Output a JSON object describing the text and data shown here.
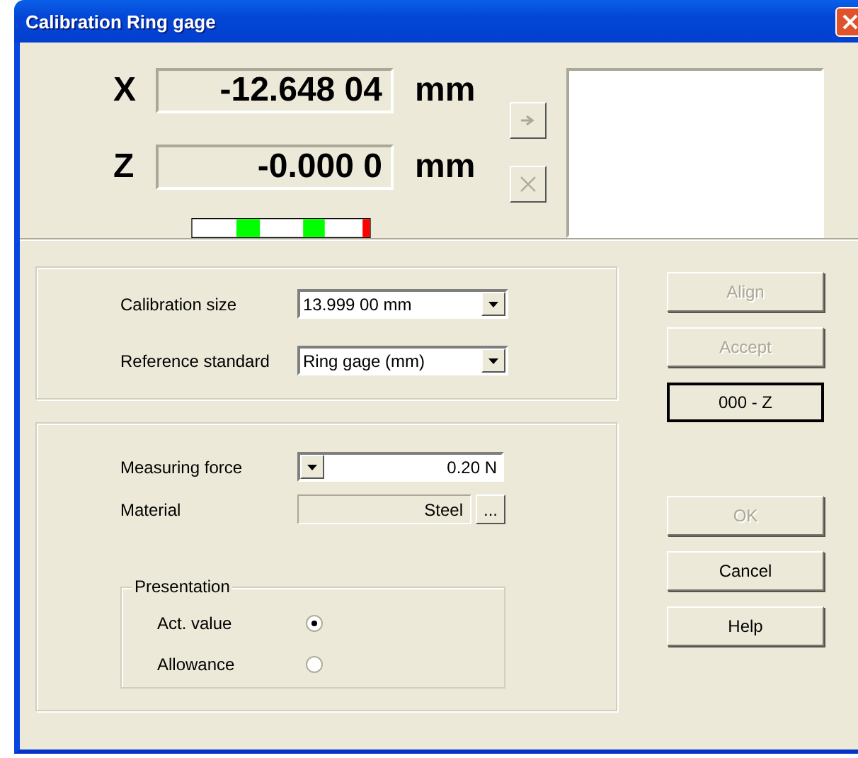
{
  "window": {
    "title": "Calibration Ring gage"
  },
  "readouts": [
    {
      "axis": "X",
      "value": "-12.648 04",
      "unit": "mm"
    },
    {
      "axis": "Z",
      "value": "-0.000 0",
      "unit": "mm"
    }
  ],
  "side_buttons": [
    {
      "kind": "arrow",
      "disabled": true
    },
    {
      "kind": "cross",
      "disabled": true
    }
  ],
  "calibration_group": {
    "fields": [
      {
        "kind": "combo",
        "label": "Calibration size",
        "value": "13.999 00 mm"
      },
      {
        "kind": "combo",
        "label": "Reference standard",
        "value": "Ring gage (mm)"
      }
    ]
  },
  "measure_group": {
    "fields": [
      {
        "kind": "dropdown-left",
        "label": "Measuring force",
        "value": "0.20 N"
      },
      {
        "kind": "browse",
        "label": "Material",
        "value": "Steel",
        "button": "..."
      }
    ],
    "presentation": {
      "title": "Presentation",
      "options": [
        {
          "label": "Act. value",
          "selected": true
        },
        {
          "label": "Allowance",
          "selected": false
        }
      ]
    }
  },
  "buttons_top": [
    {
      "label": "Align",
      "disabled": true,
      "focused": false
    },
    {
      "label": "Accept",
      "disabled": true,
      "focused": false
    },
    {
      "label": "000 - Z",
      "disabled": false,
      "focused": true
    }
  ],
  "buttons_bottom": [
    {
      "label": "OK",
      "disabled": true,
      "focused": false
    },
    {
      "label": "Cancel",
      "disabled": false,
      "focused": false
    },
    {
      "label": "Help",
      "disabled": false,
      "focused": false
    }
  ]
}
